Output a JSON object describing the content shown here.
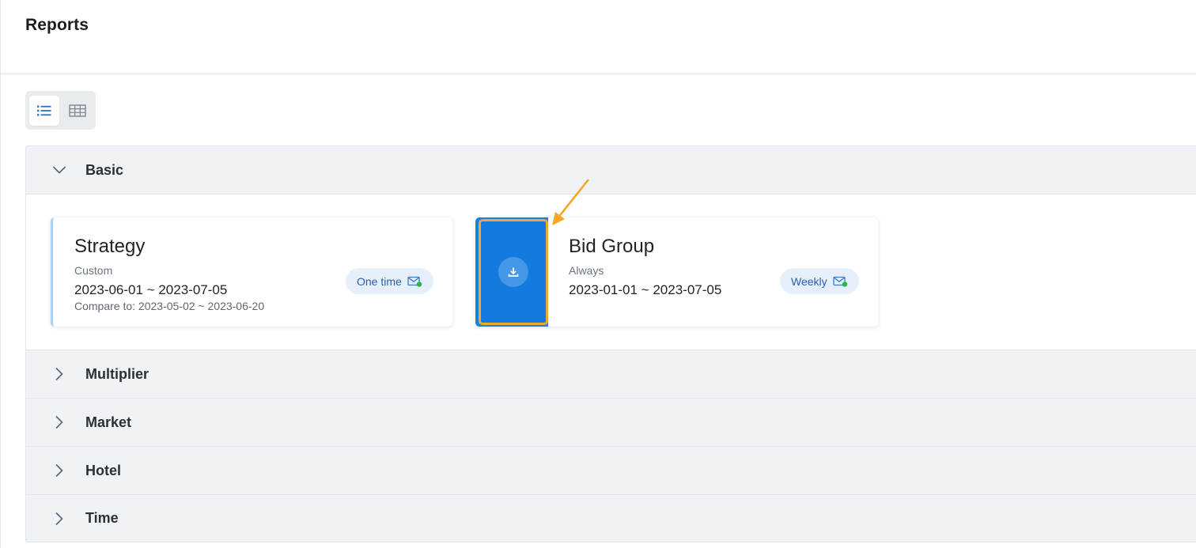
{
  "page": {
    "title": "Reports"
  },
  "view_toggle": {
    "list_icon": "list-icon",
    "table_icon": "table-grid-icon",
    "active": "list"
  },
  "groups": [
    {
      "label": "Basic",
      "expanded": true,
      "cards": [
        {
          "title": "Strategy",
          "period_type": "Custom",
          "date_range": "2023-06-01 ~ 2023-07-05",
          "compare": "Compare to: 2023-05-02 ~ 2023-06-20",
          "schedule": "One time",
          "schedule_icon": "mail-check-icon"
        },
        {
          "title": "Bid Group",
          "period_type": "Always",
          "date_range": "2023-01-01 ~ 2023-07-05",
          "schedule": "Weekly",
          "schedule_icon": "mail-check-icon",
          "action_icon": "download-icon"
        }
      ]
    },
    {
      "label": "Multiplier",
      "expanded": false
    },
    {
      "label": "Market",
      "expanded": false
    },
    {
      "label": "Hotel",
      "expanded": false
    },
    {
      "label": "Time",
      "expanded": false
    }
  ],
  "colors": {
    "accent": "#1a7fe0",
    "highlight": "#f0a830",
    "badge_bg": "#e6f0fb",
    "badge_text": "#2a5db0",
    "mail_dot": "#2cb34a"
  }
}
